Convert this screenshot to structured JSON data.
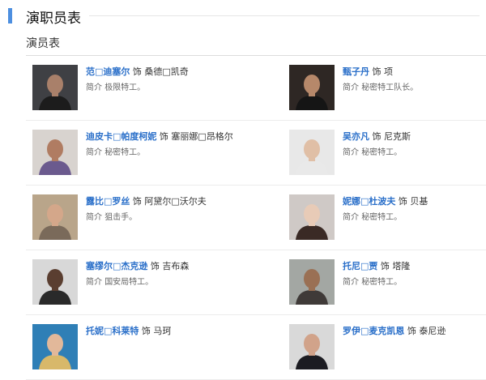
{
  "header": {
    "title": "演职员表"
  },
  "section": {
    "title": "演员表"
  },
  "cast": [
    {
      "actor": "范□迪塞尔",
      "as": "饰",
      "role": "桑德□凯奇",
      "intro_label": "简介",
      "intro": "极限特工。",
      "bg": "#3f4044",
      "skin": "#a9806a",
      "shirt": "#1c1c1c"
    },
    {
      "actor": "甄子丹",
      "as": "饰",
      "role": "项",
      "intro_label": "简介",
      "intro": "秘密特工队长。",
      "bg": "#2e2724",
      "skin": "#b6886a",
      "shirt": "#151515"
    },
    {
      "actor": "迪皮卡□帕度柯妮",
      "as": "饰",
      "role": "塞丽娜□昂格尔",
      "intro_label": "简介",
      "intro": "秘密特工。",
      "bg": "#d8d3cf",
      "skin": "#b07c62",
      "shirt": "#6b5a8e"
    },
    {
      "actor": "吴亦凡",
      "as": "饰",
      "role": "尼克斯",
      "intro_label": "简介",
      "intro": "秘密特工。",
      "bg": "#e8e8e8",
      "skin": "#e0bfa6",
      "shirt": "#e9e9e9"
    },
    {
      "actor": "露比□罗丝",
      "as": "饰",
      "role": "阿黛尔□沃尔夫",
      "intro_label": "简介",
      "intro": "狙击手。",
      "bg": "#b9a58a",
      "skin": "#d4a78a",
      "shirt": "#7a6a5a"
    },
    {
      "actor": "妮娜□杜波夫",
      "as": "饰",
      "role": "贝基",
      "intro_label": "简介",
      "intro": "秘密特工。",
      "bg": "#cfc9c6",
      "skin": "#e8cbb7",
      "shirt": "#3a2a25"
    },
    {
      "actor": "塞缪尔□杰克逊",
      "as": "饰",
      "role": "吉布森",
      "intro_label": "简介",
      "intro": "国安局特工。",
      "bg": "#d8d8d8",
      "skin": "#5a3e30",
      "shirt": "#2a2a2a"
    },
    {
      "actor": "托尼□贾",
      "as": "饰",
      "role": "塔隆",
      "intro_label": "简介",
      "intro": "秘密特工。",
      "bg": "#a3a7a3",
      "skin": "#9a7054",
      "shirt": "#3f3a38"
    },
    {
      "actor": "托妮□科莱特",
      "as": "饰",
      "role": "马珂",
      "intro_label": "",
      "intro": "",
      "bg": "#2f7fb6",
      "skin": "#e2b89a",
      "shirt": "#d8b86a"
    },
    {
      "actor": "罗伊□麦克凯恩",
      "as": "饰",
      "role": "泰尼逊",
      "intro_label": "",
      "intro": "",
      "bg": "#d9d9d9",
      "skin": "#d1a38a",
      "shirt": "#1c1c22"
    }
  ]
}
